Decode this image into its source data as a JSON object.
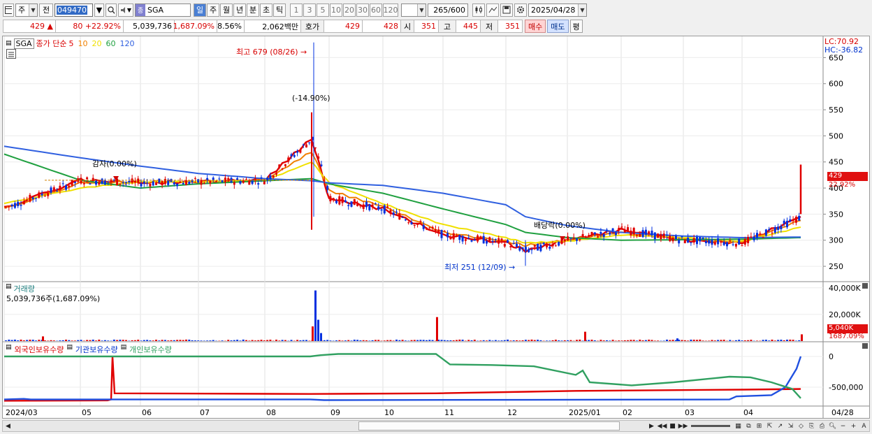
{
  "toolbar": {
    "period_unit": "주",
    "prev_label": "전",
    "stock_code": "049470",
    "stock_name": "SGA",
    "timeframes": [
      "일",
      "주",
      "월",
      "년",
      "분",
      "초",
      "틱"
    ],
    "active_timeframe": "일",
    "intervals": [
      "1",
      "3",
      "5",
      "10",
      "20",
      "30",
      "60",
      "120"
    ],
    "count_display": "265/600",
    "date": "2025/04/28"
  },
  "quote": {
    "price": "429",
    "change": "80",
    "change_pct": "+22.92%",
    "volume": "5,039,736",
    "volume_ratio": "1,687.09%",
    "turnover": "8.56%",
    "amount": "2,062백만",
    "hoga_label": "호가",
    "ask": "429",
    "bid": "428",
    "open_label": "시",
    "open": "351",
    "high_label": "고",
    "high": "445",
    "low_label": "저",
    "low": "351",
    "buy_label": "매수",
    "sell_label": "매도",
    "eval_label": "평"
  },
  "price_panel": {
    "code_label": "SGA",
    "ma_title": "종가 단순",
    "ma_periods": [
      "5",
      "10",
      "20",
      "60",
      "120"
    ],
    "lc_label": "LC:70.92",
    "hc_label": "HC:-36.82",
    "y_ticks": [
      "650",
      "600",
      "550",
      "500",
      "450",
      "400",
      "350",
      "300",
      "250"
    ],
    "last_price_tag": "429",
    "last_pct_tag": "22.92%",
    "annotation_high": "최고 679 (08/26)",
    "annotation_low": "최저 251 (12/09)",
    "annotation_drop": "(-14.90%)",
    "annotation_cap": "감자(0.00%)",
    "annotation_div": "배당락(0.00%)"
  },
  "volume_panel": {
    "title": "거래량",
    "subtitle": "5,039,736주(1,687.09%)",
    "y_ticks": [
      "40,000K",
      "20,000K"
    ],
    "last_tag": "5,040K",
    "last_pct_tag": "1687.09%"
  },
  "holding_panel": {
    "legend": [
      "외국인보유수량",
      "기관보유수량",
      "개인보유수량"
    ],
    "y_ticks": [
      "0",
      "-500,000"
    ]
  },
  "x_axis": {
    "labels": [
      "2024/03",
      "05",
      "06",
      "07",
      "08",
      "09",
      "10",
      "11",
      "12",
      "2025/01",
      "02",
      "03",
      "04"
    ],
    "right_label": "04/28"
  },
  "colors": {
    "ma5": "#e00000",
    "ma10": "#f08000",
    "ma20": "#f0e000",
    "ma60": "#20a040",
    "ma120": "#3060e0",
    "up": "#e00000",
    "down": "#0030e0",
    "foreign": "#e00000",
    "inst": "#2050e0",
    "retail": "#30a060"
  },
  "chart_data": {
    "type": "line",
    "x": [
      "2024/03",
      "05",
      "06",
      "07",
      "08",
      "08/26",
      "09",
      "10",
      "11",
      "12",
      "12/09",
      "2025/01",
      "02",
      "03",
      "04",
      "04/28"
    ],
    "series": [
      {
        "name": "5",
        "values": [
          362,
          415,
          410,
          412,
          415,
          495,
          380,
          360,
          310,
          295,
          280,
          300,
          320,
          300,
          295,
          345
        ]
      },
      {
        "name": "10",
        "values": [
          360,
          410,
          412,
          412,
          415,
          470,
          395,
          365,
          315,
          298,
          290,
          300,
          315,
          302,
          296,
          338
        ]
      },
      {
        "name": "20",
        "values": [
          370,
          400,
          412,
          412,
          414,
          450,
          410,
          370,
          330,
          305,
          295,
          298,
          310,
          305,
          298,
          325
        ]
      },
      {
        "name": "60",
        "values": [
          465,
          415,
          400,
          408,
          414,
          418,
          408,
          390,
          360,
          330,
          315,
          305,
          300,
          301,
          302,
          305
        ]
      },
      {
        "name": "120",
        "values": [
          480,
          458,
          442,
          428,
          418,
          414,
          410,
          405,
          390,
          368,
          345,
          328,
          315,
          308,
          305,
          306
        ]
      }
    ],
    "ylim": [
      230,
      680
    ],
    "high": 679,
    "low": 251,
    "close": 429
  }
}
